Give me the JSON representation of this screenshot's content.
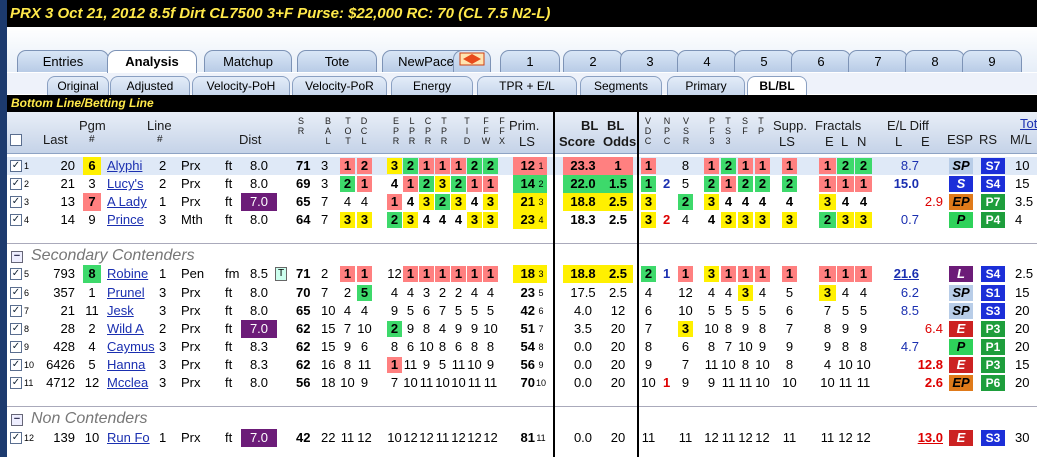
{
  "title": "PRX  3   Oct 21, 2012        8.5f  Dirt   CL7500  3+F   Purse: $22,000   RC: 70  (CL 7.5 N2-L)",
  "tabs": [
    "Entries",
    "Analysis",
    "Matchup",
    "Tote",
    "NewPace",
    "1",
    "2",
    "3",
    "4",
    "5",
    "6",
    "7",
    "8",
    "9"
  ],
  "subtabs": [
    "Original",
    "Adjusted",
    "Velocity-PoH",
    "Velocity-PoR",
    "Energy",
    "TPR + E/L",
    "Segments",
    "Primary",
    "BL/BL"
  ],
  "bottom_line": "Bottom Line/Betting Line",
  "headers": {
    "last": "Last",
    "pgm": "Pgm",
    "pgm_hash": "#",
    "line": "Line",
    "line_hash": "#",
    "dist": "Dist",
    "prim": "Prim.",
    "prim_ls": "LS",
    "bl_score": "BL",
    "score": "Score",
    "bl_odds": "BL",
    "odds": "Odds",
    "supp": "Supp.",
    "supp_ls": "LS",
    "fractals": "Fractals",
    "fr_e": "E",
    "fr_l": "L",
    "fr_n": "N",
    "el": "E/L Diff",
    "el_l": "L",
    "el_e": "E",
    "esp": "ESP",
    "rs": "RS",
    "tote": "Tote",
    "ml": "M/L"
  },
  "vheaders": [
    "SR",
    "BAL",
    "TOT",
    "DCL",
    "EPR",
    "LPR",
    "CPR",
    "TPR",
    "TID",
    "FFW",
    "FFX",
    "VDC",
    "NPC",
    "VSR",
    "PF3",
    "TS3",
    "SF",
    "TP"
  ],
  "groups": [
    "Secondary Contenders",
    "Non Contenders"
  ],
  "rows": [
    {
      "n": "1",
      "last": "20",
      "pgm": "6",
      "line": "2",
      "tr": "Prx",
      "horse": "Alyphi",
      "surf": "ft",
      "dist": "8.0",
      "sr": "71",
      "bal": "3",
      "t": [
        "1",
        "2"
      ],
      "epr": [
        "3",
        "2",
        "1",
        "1",
        "1",
        "2",
        "2"
      ],
      "prim": "12",
      "primls": "1",
      "score": "23.3",
      "odds": "1",
      "vd": "1",
      "np": "",
      "vs": "8",
      "pf": [
        "1",
        "2",
        "1",
        "1"
      ],
      "supp": "1",
      "fr": [
        "1",
        "2",
        "2"
      ],
      "eld": "8.7",
      "elc": "#1a2fb0",
      "esp": "SP",
      "rs": "S7",
      "ml": "10"
    },
    {
      "n": "2",
      "last": "21",
      "pgm": "3",
      "line": "2",
      "tr": "Prx",
      "horse": "Lucy's",
      "surf": "ft",
      "dist": "8.0",
      "sr": "69",
      "bal": "3",
      "t": [
        "2",
        "1"
      ],
      "epr": [
        "4",
        "1",
        "2",
        "3",
        "2",
        "1",
        "1"
      ],
      "prim": "14",
      "primls": "2",
      "score": "22.0",
      "odds": "1.5",
      "vd": "1",
      "np": "2",
      "vs": "5",
      "pf": [
        "2",
        "1",
        "2",
        "2"
      ],
      "supp": "2",
      "fr": [
        "1",
        "1",
        "1"
      ],
      "eld": "15.0",
      "elc": "#1a2fb0",
      "esp": "S",
      "rs": "S4",
      "ml": "15"
    },
    {
      "n": "3",
      "last": "13",
      "pgm": "7",
      "line": "1",
      "tr": "Prx",
      "horse": "A Lady",
      "surf": "ft",
      "dist": "7.0",
      "sr": "65",
      "bal": "7",
      "t": [
        "4",
        "4"
      ],
      "epr": [
        "1",
        "4",
        "3",
        "2",
        "3",
        "4",
        "3"
      ],
      "prim": "21",
      "primls": "3",
      "score": "18.8",
      "odds": "2.5",
      "vd": "3",
      "np": "",
      "vs": "2",
      "pf": [
        "3",
        "4",
        "4",
        "4"
      ],
      "supp": "4",
      "fr": [
        "3",
        "4",
        "4"
      ],
      "eld": "2.9",
      "elc": "#d00",
      "esp": "EP",
      "rs": "P7",
      "ml": "3.5"
    },
    {
      "n": "4",
      "last": "14",
      "pgm": "9",
      "line": "3",
      "tr": "Mth",
      "horse": "Prince",
      "surf": "ft",
      "dist": "8.0",
      "sr": "64",
      "bal": "7",
      "t": [
        "3",
        "3"
      ],
      "epr": [
        "2",
        "3",
        "4",
        "4",
        "4",
        "3",
        "3"
      ],
      "prim": "23",
      "primls": "4",
      "score": "18.3",
      "odds": "2.5",
      "vd": "3",
      "np": "2",
      "vs": "4",
      "pf": [
        "4",
        "3",
        "3",
        "3"
      ],
      "supp": "3",
      "fr": [
        "2",
        "3",
        "3"
      ],
      "eld": "0.7",
      "elc": "#1a2fb0",
      "esp": "P",
      "rs": "P4",
      "ml": "4"
    },
    {
      "n": "5",
      "last": "793",
      "pgm": "8",
      "line": "1",
      "tr": "Pen",
      "horse": "Robine",
      "surf": "fm",
      "dist": "8.5",
      "sr": "71",
      "bal": "2",
      "t": [
        "1",
        "1"
      ],
      "epr": [
        "12",
        "1",
        "1",
        "1",
        "1",
        "1",
        "1"
      ],
      "prim": "18",
      "primls": "3",
      "score": "18.8",
      "odds": "2.5",
      "vd": "2",
      "np": "1",
      "vs": "1",
      "pf": [
        "3",
        "1",
        "1",
        "1"
      ],
      "supp": "1",
      "fr": [
        "1",
        "1",
        "1"
      ],
      "eld": "21.6",
      "elc": "#1a2fb0",
      "esp": "L",
      "rs": "S4",
      "ml": "2.5"
    },
    {
      "n": "6",
      "last": "357",
      "pgm": "1",
      "line": "3",
      "tr": "Prx",
      "horse": "Prunel",
      "surf": "ft",
      "dist": "8.0",
      "sr": "70",
      "bal": "7",
      "t": [
        "2",
        "5"
      ],
      "epr": [
        "4",
        "4",
        "3",
        "2",
        "2",
        "4",
        "4"
      ],
      "prim": "23",
      "primls": "5",
      "score": "17.5",
      "odds": "2.5",
      "vd": "4",
      "np": "",
      "vs": "12",
      "pf": [
        "4",
        "4",
        "3",
        "4"
      ],
      "supp": "5",
      "fr": [
        "3",
        "4",
        "4"
      ],
      "eld": "6.2",
      "elc": "#1a2fb0",
      "esp": "SP",
      "rs": "S1",
      "ml": "15"
    },
    {
      "n": "7",
      "last": "21",
      "pgm": "11",
      "line": "3",
      "tr": "Prx",
      "horse": "Jesk",
      "surf": "ft",
      "dist": "8.0",
      "sr": "65",
      "bal": "10",
      "t": [
        "4",
        "4"
      ],
      "epr": [
        "9",
        "5",
        "6",
        "7",
        "5",
        "5",
        "5"
      ],
      "prim": "42",
      "primls": "6",
      "score": "4.0",
      "odds": "12",
      "vd": "6",
      "np": "",
      "vs": "10",
      "pf": [
        "5",
        "5",
        "5",
        "5"
      ],
      "supp": "6",
      "fr": [
        "7",
        "5",
        "5"
      ],
      "eld": "8.5",
      "elc": "#1a2fb0",
      "esp": "SP",
      "rs": "S3",
      "ml": "20"
    },
    {
      "n": "8",
      "last": "28",
      "pgm": "2",
      "line": "2",
      "tr": "Prx",
      "horse": "Wild A",
      "surf": "ft",
      "dist": "7.0",
      "sr": "62",
      "bal": "15",
      "t": [
        "7",
        "10"
      ],
      "epr": [
        "2",
        "9",
        "8",
        "4",
        "9",
        "9",
        "10"
      ],
      "prim": "51",
      "primls": "7",
      "score": "3.5",
      "odds": "20",
      "vd": "7",
      "np": "",
      "vs": "3",
      "pf": [
        "10",
        "8",
        "9",
        "8"
      ],
      "supp": "7",
      "fr": [
        "8",
        "9",
        "9"
      ],
      "eld": "6.4",
      "elc": "#d00",
      "esp": "E",
      "rs": "P3",
      "ml": "20"
    },
    {
      "n": "9",
      "last": "428",
      "pgm": "4",
      "line": "3",
      "tr": "Prx",
      "horse": "Caymus",
      "surf": "ft",
      "dist": "8.3",
      "sr": "62",
      "bal": "15",
      "t": [
        "9",
        "6"
      ],
      "epr": [
        "8",
        "6",
        "10",
        "8",
        "6",
        "8",
        "8"
      ],
      "prim": "54",
      "primls": "8",
      "score": "0.0",
      "odds": "20",
      "vd": "8",
      "np": "",
      "vs": "6",
      "pf": [
        "8",
        "7",
        "10",
        "9"
      ],
      "supp": "9",
      "fr": [
        "9",
        "8",
        "8"
      ],
      "eld": "4.7",
      "elc": "#1a2fb0",
      "esp": "P",
      "rs": "P1",
      "ml": "20"
    },
    {
      "n": "10",
      "last": "6426",
      "pgm": "5",
      "line": "3",
      "tr": "Prx",
      "horse": "Hanna",
      "surf": "ft",
      "dist": "8.3",
      "sr": "62",
      "bal": "16",
      "t": [
        "8",
        "11"
      ],
      "epr": [
        "1",
        "11",
        "9",
        "5",
        "11",
        "10",
        "9"
      ],
      "prim": "56",
      "primls": "9",
      "score": "0.0",
      "odds": "20",
      "vd": "9",
      "np": "",
      "vs": "7",
      "pf": [
        "11",
        "10",
        "8",
        "10"
      ],
      "supp": "8",
      "fr": [
        "4",
        "10",
        "10"
      ],
      "eld": "12.8",
      "elc": "#d00",
      "esp": "E",
      "rs": "P3",
      "ml": "15"
    },
    {
      "n": "11",
      "last": "4712",
      "pgm": "12",
      "line": "3",
      "tr": "Prx",
      "horse": "Mcclea",
      "surf": "ft",
      "dist": "8.0",
      "sr": "56",
      "bal": "18",
      "t": [
        "10",
        "9"
      ],
      "epr": [
        "7",
        "10",
        "11",
        "10",
        "10",
        "11",
        "11"
      ],
      "prim": "70",
      "primls": "10",
      "score": "0.0",
      "odds": "20",
      "vd": "10",
      "np": "1",
      "vs": "9",
      "pf": [
        "9",
        "11",
        "11",
        "10"
      ],
      "supp": "10",
      "fr": [
        "10",
        "11",
        "11"
      ],
      "eld": "2.6",
      "elc": "#d00",
      "esp": "EP",
      "rs": "P6",
      "ml": "20"
    },
    {
      "n": "12",
      "last": "139",
      "pgm": "10",
      "line": "1",
      "tr": "Prx",
      "horse": "Run Fo",
      "surf": "ft",
      "dist": "7.0",
      "sr": "42",
      "bal": "22",
      "t": [
        "11",
        "12"
      ],
      "epr": [
        "10",
        "12",
        "12",
        "11",
        "12",
        "12",
        "12"
      ],
      "prim": "81",
      "primls": "11",
      "score": "0.0",
      "odds": "20",
      "vd": "11",
      "np": "",
      "vs": "11",
      "pf": [
        "12",
        "11",
        "12",
        "12"
      ],
      "supp": "11",
      "fr": [
        "11",
        "12",
        "12"
      ],
      "eld": "13.0",
      "elc": "#d00",
      "esp": "E",
      "rs": "S3",
      "ml": "30"
    }
  ]
}
